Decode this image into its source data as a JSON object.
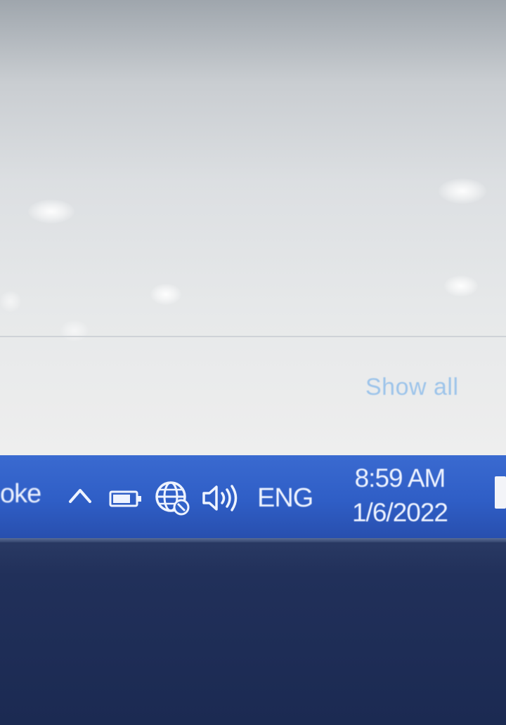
{
  "panel": {
    "show_all_label": "Show all"
  },
  "taskbar": {
    "app_label_fragment": "oke",
    "tray": {
      "chevron_icon": "chevron-up-icon",
      "battery_icon": "battery-icon",
      "network_icon": "globe-network-icon",
      "volume_icon": "speaker-volume-icon",
      "language": "ENG"
    },
    "clock": {
      "time": "8:59 AM",
      "date": "1/6/2022"
    }
  },
  "colors": {
    "taskbar": "#3163c9",
    "link": "#9dc4ea",
    "panel": "#e6e8ea",
    "bezel": "#1c2b54"
  }
}
